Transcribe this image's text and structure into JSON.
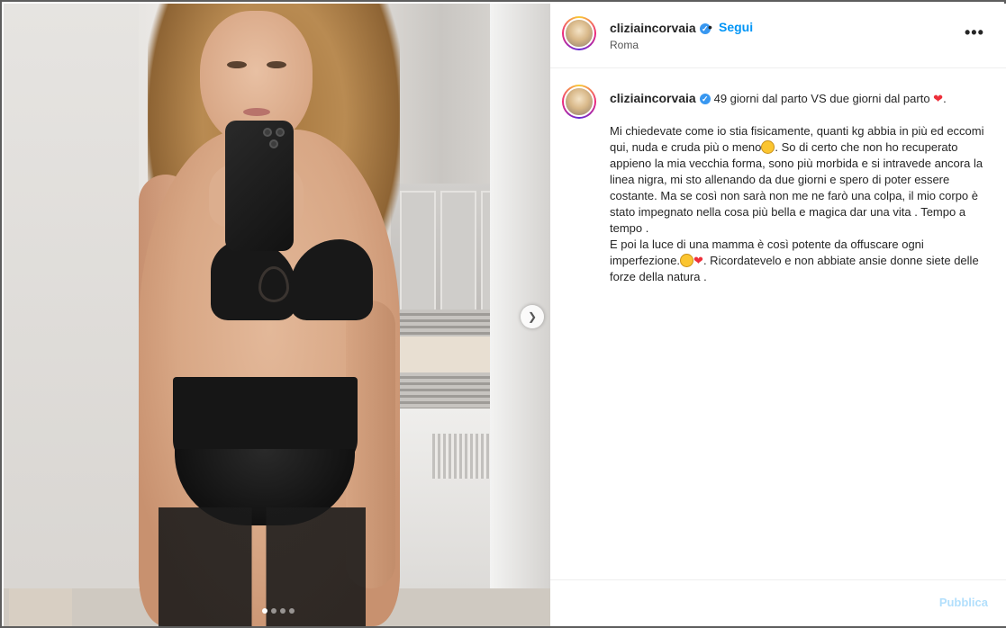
{
  "post": {
    "username": "cliziaincorvaia",
    "follow_label": "Segui",
    "separator": "•",
    "location": "Roma",
    "more_label": "•••",
    "verified_mark": "✓"
  },
  "caption": {
    "username": "cliziaincorvaia",
    "line1_text": " 49 giorni dal parto VS due giorni dal parto ",
    "line1_heart": "❤",
    "line1_end": ".",
    "p2_part1": "Mi chiedevate come io stia fisicamente, quanti kg abbia in più ed eccomi qui, nuda e cruda più o meno",
    "p2_part2": ". So di certo che non ho recuperato appieno la mia vecchia forma, sono più morbida e si intravede ancora la linea nigra, mi sto allenando da due giorni e spero di poter essere costante. Ma se così non sarà non me ne farò una colpa, il mio corpo è stato impegnato nella cosa più bella e magica dar una vita . Tempo a tempo .",
    "p3_part1": "E poi la luce di una mamma è così potente da offuscare ogni imperfezione.",
    "p3_heart": "❤",
    "p3_part2": ". Ricordatevelo e non abbiate ansie donne siete delle forze della natura ."
  },
  "composer": {
    "publish_label": "Pubblica"
  },
  "carousel": {
    "next_label": "❯",
    "dots": 4,
    "active_dot": 0
  },
  "icons": [
    "verified-badge-icon",
    "more-options-icon",
    "chevron-right-icon",
    "red-heart-icon",
    "grinning-emoji-icon",
    "smiling-emoji-icon"
  ],
  "colors": {
    "link_blue": "#0095f6",
    "verified_blue": "#3897f0",
    "publish_disabled": "#b2dffc",
    "heart_red": "#ed2f3a"
  }
}
